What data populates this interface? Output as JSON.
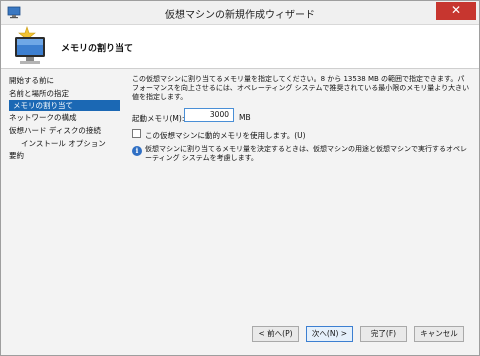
{
  "window": {
    "title": "仮想マシンの新規作成ウィザード",
    "close_glyph": "✕"
  },
  "header": {
    "title": "メモリの割り当て"
  },
  "sidebar": {
    "items": [
      {
        "label": "開始する前に",
        "selected": false,
        "sub": false
      },
      {
        "label": "名前と場所の指定",
        "selected": false,
        "sub": false
      },
      {
        "label": "メモリの割り当て",
        "selected": true,
        "sub": false
      },
      {
        "label": "ネットワークの構成",
        "selected": false,
        "sub": false
      },
      {
        "label": "仮想ハード ディスクの接続",
        "selected": false,
        "sub": false
      },
      {
        "label": "インストール オプション",
        "selected": false,
        "sub": true
      },
      {
        "label": "要約",
        "selected": false,
        "sub": false
      }
    ]
  },
  "main": {
    "description": "この仮想マシンに割り当てるメモリ量を指定してください。8 から 13538 MB の範囲で指定できます。パフォーマンスを向上させるには、オペレーティング システムで推奨されている最小限のメモリ量より大きい値を指定します。",
    "memory_label": "起動メモリ(M):",
    "memory_value": "3000",
    "memory_unit": "MB",
    "dynamic_memory_label": "この仮想マシンに動的メモリを使用します。(U)",
    "dynamic_memory_checked": false,
    "info_text": "仮想マシンに割り当てるメモリ量を決定するときは、仮想マシンの用途と仮想マシンで実行するオペレーティング システムを考慮します。"
  },
  "footer": {
    "prev_label": "< 前へ(P)",
    "next_label": "次へ(N) >",
    "finish_label": "完了(F)",
    "cancel_label": "キャンセル"
  },
  "colors": {
    "accent": "#1b68b4",
    "close": "#c7362f",
    "info": "#2f6fc4"
  }
}
